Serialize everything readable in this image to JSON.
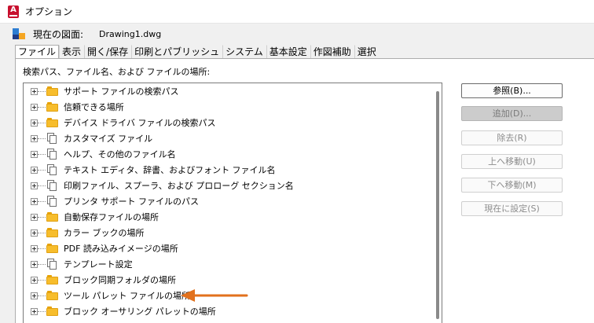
{
  "window": {
    "title": "オプション"
  },
  "drawing": {
    "label": "現在の図面:",
    "value": "Drawing1.dwg"
  },
  "tabs": [
    {
      "label": "ファイル",
      "active": true
    },
    {
      "label": "表示",
      "active": false
    },
    {
      "label": "開く/保存",
      "active": false
    },
    {
      "label": "印刷とパブリッシュ",
      "active": false
    },
    {
      "label": "システム",
      "active": false
    },
    {
      "label": "基本設定",
      "active": false
    },
    {
      "label": "作図補助",
      "active": false
    },
    {
      "label": "選択",
      "active": false
    }
  ],
  "section_label": "検索パス、ファイル名、および ファイルの場所:",
  "tree": [
    {
      "label": "サポート ファイルの検索パス",
      "icon": "folder-icon"
    },
    {
      "label": "信頼できる場所",
      "icon": "folder-icon"
    },
    {
      "label": "デバイス ドライバ ファイルの検索パス",
      "icon": "folder-icon"
    },
    {
      "label": "カスタマイズ ファイル",
      "icon": "pages-icon"
    },
    {
      "label": "ヘルプ、その他のファイル名",
      "icon": "pages-icon"
    },
    {
      "label": "テキスト エディタ、辞書、およびフォント ファイル名",
      "icon": "pages-icon"
    },
    {
      "label": "印刷ファイル、スプーラ、および プロローグ セクション名",
      "icon": "pages-icon"
    },
    {
      "label": "プリンタ サポート ファイルのパス",
      "icon": "pages-icon"
    },
    {
      "label": "自動保存ファイルの場所",
      "icon": "folder-icon"
    },
    {
      "label": "カラー ブックの場所",
      "icon": "folder-icon"
    },
    {
      "label": "PDF 読み込みイメージの場所",
      "icon": "folder-icon"
    },
    {
      "label": "テンプレート設定",
      "icon": "pages-icon"
    },
    {
      "label": "ブロック同期フォルダの場所",
      "icon": "folder-icon"
    },
    {
      "label": "ツール パレット ファイルの場所",
      "icon": "folder-icon"
    },
    {
      "label": "ブロック オーサリング パレットの場所",
      "icon": "folder-icon"
    }
  ],
  "buttons": {
    "browse": "参照(B)...",
    "add": "追加(D)...",
    "remove": "除去(R)",
    "move_up": "上へ移動(U)",
    "move_down": "下へ移動(M)",
    "set_current": "現在に設定(S)"
  },
  "colors": {
    "arrow": "#e2711d",
    "folder": "#f7bd2c",
    "brand": "#c8102e"
  }
}
